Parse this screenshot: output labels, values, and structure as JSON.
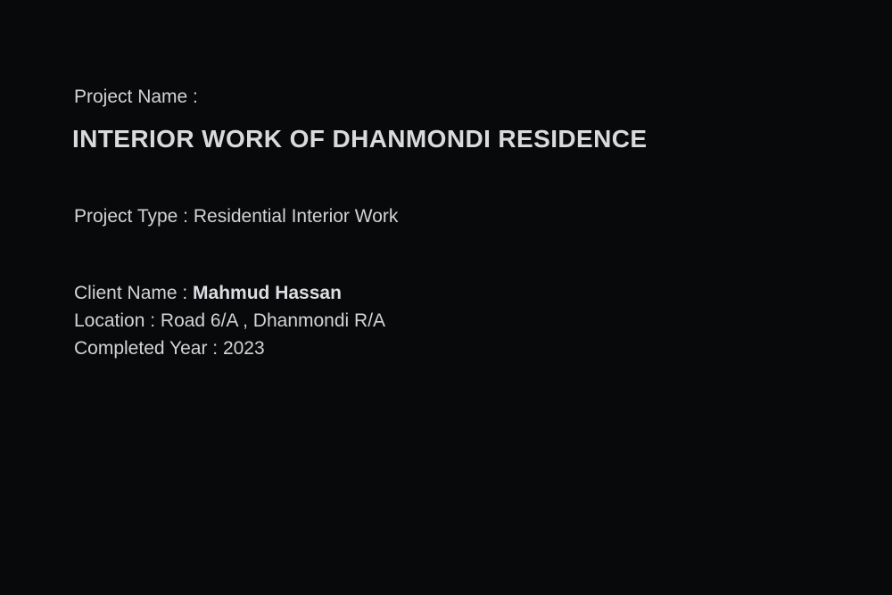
{
  "project": {
    "name_label": "Project Name :",
    "title": "INTERIOR WORK OF DHANMONDI RESIDENCE",
    "type_line": "Project Type : Residential Interior Work"
  },
  "details": {
    "client_label": "Client Name : ",
    "client_value": "Mahmud Hassan",
    "location_line": "Location : Road 6/A , Dhanmondi R/A",
    "completed_line": "Completed Year : 2023"
  },
  "colors": {
    "background": "#08090b",
    "text": "#d2d3d5"
  }
}
